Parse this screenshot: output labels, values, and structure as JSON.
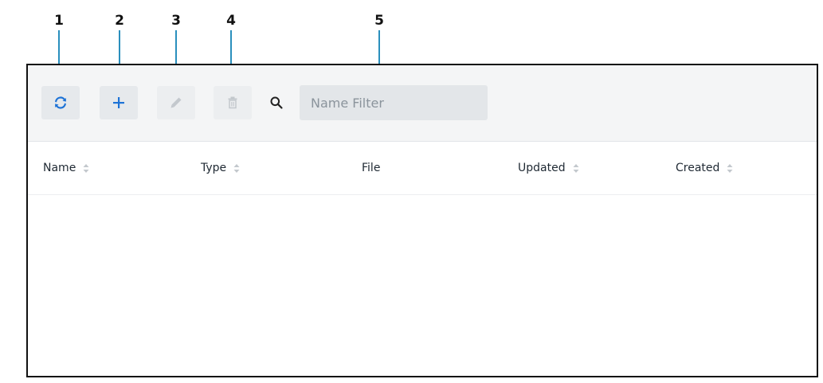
{
  "callouts": [
    "1",
    "2",
    "3",
    "4",
    "5"
  ],
  "toolbar": {
    "refresh_icon": "refresh-icon",
    "add_icon": "plus-icon",
    "edit_icon": "pencil-icon",
    "delete_icon": "trash-icon",
    "search_icon": "search-icon",
    "name_filter_placeholder": "Name Filter",
    "name_filter_value": ""
  },
  "table": {
    "columns": [
      {
        "label": "Name",
        "sortable": true
      },
      {
        "label": "Type",
        "sortable": true
      },
      {
        "label": "File",
        "sortable": false
      },
      {
        "label": "Updated",
        "sortable": true
      },
      {
        "label": "Created",
        "sortable": true
      }
    ],
    "rows": []
  },
  "colors": {
    "accent": "#1e73d6",
    "leader": "#2a8fbd",
    "disabled_icon": "#c3c8cd"
  }
}
